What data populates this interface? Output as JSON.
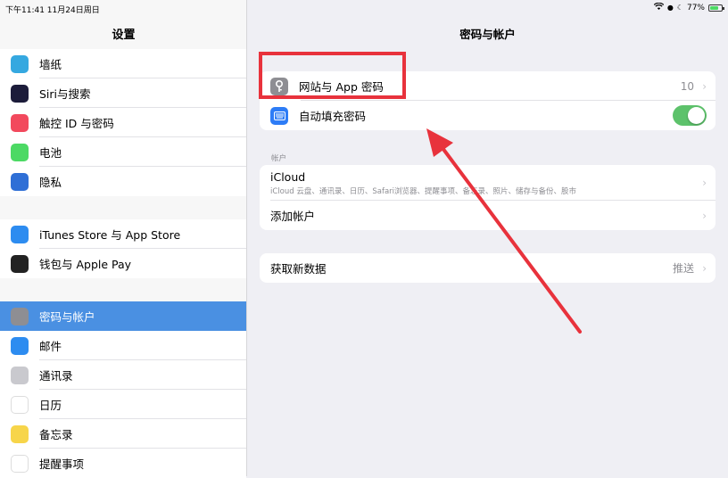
{
  "status": {
    "time_date": "下午11:41  11月24日周日",
    "battery_text": "77%",
    "battery_level": 0.77
  },
  "sidebar": {
    "title": "设置",
    "group1": [
      {
        "label": "墙纸",
        "icon": "wallpaper-icon",
        "color": "#35a8e0"
      },
      {
        "label": "Siri与搜索",
        "icon": "siri-icon",
        "color": "#1c1c3a"
      },
      {
        "label": "触控 ID 与密码",
        "icon": "fingerprint-icon",
        "color": "#f2495d"
      },
      {
        "label": "电池",
        "icon": "battery-icon",
        "color": "#4cd964"
      },
      {
        "label": "隐私",
        "icon": "hand-icon",
        "color": "#2f6fd6"
      }
    ],
    "group2": [
      {
        "label": "iTunes Store 与 App Store",
        "icon": "app-store-icon",
        "color": "#2d8cf0"
      },
      {
        "label": "钱包与 Apple Pay",
        "icon": "wallet-icon",
        "color": "#222222"
      }
    ],
    "group3": [
      {
        "label": "密码与帐户",
        "icon": "key-icon",
        "color": "#8e8e93",
        "selected": true
      },
      {
        "label": "邮件",
        "icon": "mail-icon",
        "color": "#2d8cf0"
      },
      {
        "label": "通讯录",
        "icon": "contacts-icon",
        "color": "#c9c9ce"
      },
      {
        "label": "日历",
        "icon": "calendar-icon",
        "color": "#ffffff"
      },
      {
        "label": "备忘录",
        "icon": "notes-icon",
        "color": "#f7d54a"
      },
      {
        "label": "提醒事项",
        "icon": "reminders-icon",
        "color": "#ffffff"
      }
    ]
  },
  "main": {
    "title": "密码与帐户",
    "passwords": {
      "website_label": "网站与 App 密码",
      "website_count": "10",
      "autofill_label": "自动填充密码",
      "autofill_on": true
    },
    "accounts": {
      "header": "帐户",
      "icloud_label": "iCloud",
      "icloud_sub": "iCloud 云盘、通讯录、日历、Safari浏览器、提醒事项、备忘录、照片、储存与备份、股市",
      "add_label": "添加帐户"
    },
    "fetch": {
      "label": "获取新数据",
      "value": "推送"
    }
  },
  "colors": {
    "selection": "#4a90e2",
    "highlight": "#e8323c",
    "toggle": "#5dc26b"
  }
}
